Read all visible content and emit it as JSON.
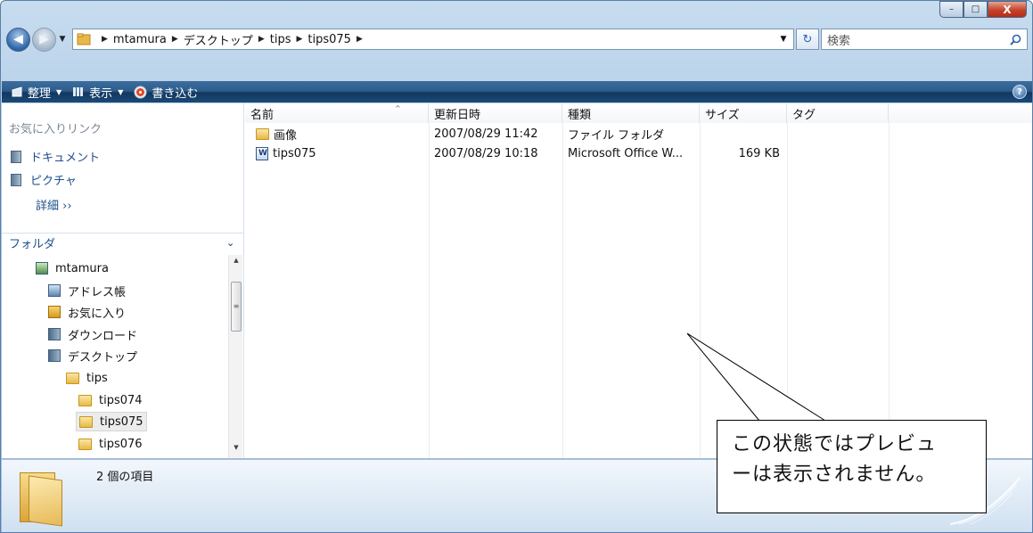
{
  "window": {
    "caption": {
      "minimize": "–",
      "maximize": "□",
      "close": "X"
    }
  },
  "address_bar": {
    "back_icon": "back-arrow-icon",
    "forward_icon": "forward-arrow-icon",
    "crumbs": [
      "mtamura",
      "デスクトップ",
      "tips",
      "tips075"
    ],
    "search_placeholder": "検索"
  },
  "command_bar": {
    "organize": "整理",
    "views": "表示",
    "burn": "書き込む",
    "help": "?"
  },
  "nav_pane": {
    "favorites_title": "お気に入りリンク",
    "favorites": [
      "ドキュメント",
      "ピクチャ"
    ],
    "more": "詳細 ››",
    "folders_title": "フォルダ",
    "tree": [
      {
        "label": "mtamura",
        "icon": "user-folder-icon"
      },
      {
        "label": "アドレス帳",
        "icon": "contacts-icon"
      },
      {
        "label": "お気に入り",
        "icon": "favorites-icon"
      },
      {
        "label": "ダウンロード",
        "icon": "downloads-icon"
      },
      {
        "label": "デスクトップ",
        "icon": "desktop-icon"
      },
      {
        "label": "tips",
        "icon": "folder-icon"
      },
      {
        "label": "tips074",
        "icon": "folder-icon"
      },
      {
        "label": "tips075",
        "icon": "folder-icon",
        "selected": true
      },
      {
        "label": "tips076",
        "icon": "folder-icon"
      }
    ]
  },
  "file_list": {
    "columns": [
      "名前",
      "更新日時",
      "種類",
      "サイズ",
      "タグ"
    ],
    "rows": [
      {
        "name": "画像",
        "modified": "2007/08/29 11:42",
        "type": "ファイル フォルダ",
        "size": "",
        "icon": "folder-icon"
      },
      {
        "name": "tips075",
        "modified": "2007/08/29 10:18",
        "type": "Microsoft Office W...",
        "size": "169 KB",
        "icon": "word-document-icon"
      }
    ]
  },
  "details_pane": {
    "item_count": "2 個の項目"
  },
  "callout": {
    "line1": "この状態ではプレビュ",
    "line2": "ーは表示されません。"
  }
}
